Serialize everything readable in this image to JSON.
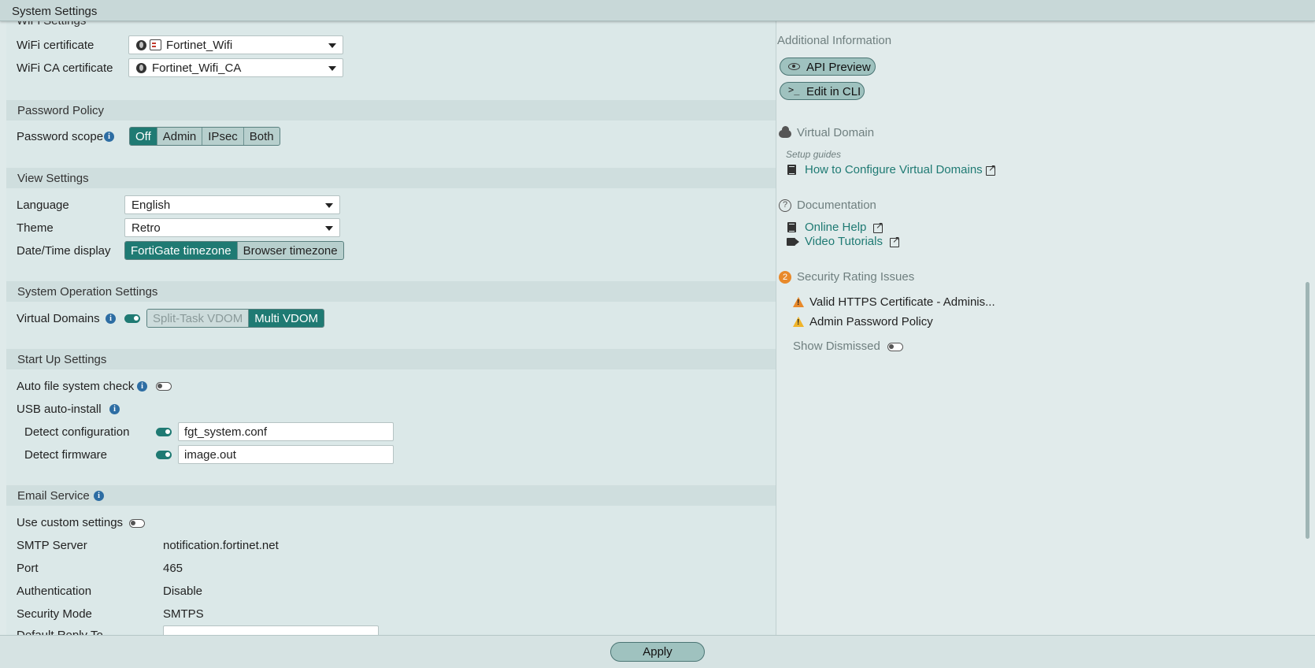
{
  "window": {
    "title": "System Settings"
  },
  "wifi": {
    "partial_heading": "WiFi Settings",
    "cert_label": "WiFi certificate",
    "cert_value": "Fortinet_Wifi",
    "ca_label": "WiFi CA certificate",
    "ca_value": "Fortinet_Wifi_CA"
  },
  "password_policy": {
    "heading": "Password Policy",
    "scope_label": "Password scope",
    "options": [
      "Off",
      "Admin",
      "IPsec",
      "Both"
    ],
    "selected": "Off"
  },
  "view_settings": {
    "heading": "View Settings",
    "language_label": "Language",
    "language_value": "English",
    "theme_label": "Theme",
    "theme_value": "Retro",
    "datetime_label": "Date/Time display",
    "datetime_options": [
      "FortiGate timezone",
      "Browser timezone"
    ],
    "datetime_selected": "FortiGate timezone"
  },
  "system_operation": {
    "heading": "System Operation Settings",
    "vdom_label": "Virtual Domains",
    "vdom_enabled": true,
    "vdom_options": [
      "Split-Task VDOM",
      "Multi VDOM"
    ],
    "vdom_selected": "Multi VDOM"
  },
  "startup": {
    "heading": "Start Up Settings",
    "auto_fs_label": "Auto file system check",
    "auto_fs_enabled": false,
    "usb_label": "USB auto-install",
    "detect_config_label": "Detect configuration",
    "detect_config_enabled": true,
    "detect_config_value": "fgt_system.conf",
    "detect_fw_label": "Detect firmware",
    "detect_fw_enabled": true,
    "detect_fw_value": "image.out"
  },
  "email": {
    "heading": "Email Service",
    "custom_label": "Use custom settings",
    "custom_enabled": false,
    "smtp_label": "SMTP Server",
    "smtp_value": "notification.fortinet.net",
    "port_label": "Port",
    "port_value": "465",
    "auth_label": "Authentication",
    "auth_value": "Disable",
    "secmode_label": "Security Mode",
    "secmode_value": "SMTPS",
    "reply_label": "Default Reply To"
  },
  "sidebar": {
    "heading": "Additional Information",
    "api_preview": "API Preview",
    "edit_cli": "Edit in CLI",
    "cli_icon_text": ">_",
    "vdom_heading": "Virtual Domain",
    "setup_guides": "Setup guides",
    "vdom_link": "How to Configure Virtual Domains",
    "docs_heading": "Documentation",
    "docs_icon_text": "?",
    "online_help": "Online Help",
    "video_tutorials": "Video Tutorials",
    "security_count": "2",
    "security_heading": "Security Rating Issues",
    "issue1": "Valid HTTPS Certificate - Adminis...",
    "issue2": "Admin Password Policy",
    "show_dismissed": "Show Dismissed",
    "show_dismissed_enabled": false
  },
  "footer": {
    "apply": "Apply"
  },
  "icons": [
    "globe-icon",
    "certificate-icon",
    "info-icon",
    "eye-icon",
    "terminal-icon",
    "cloud-icon",
    "book-icon",
    "external-link-icon",
    "help-circle-icon",
    "video-icon",
    "warning-icon",
    "chevron-down-icon"
  ],
  "colors": {
    "accent": "#1f7a73",
    "warning": "#e8892a",
    "link": "#1f7a73"
  }
}
